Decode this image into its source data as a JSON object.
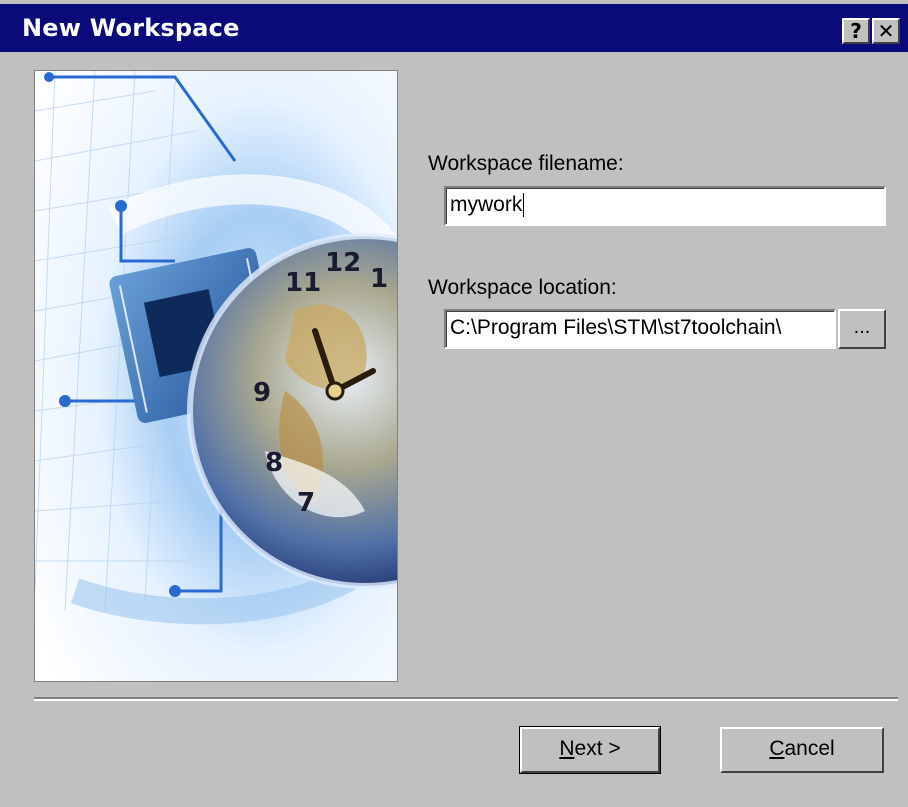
{
  "window": {
    "title": "New Workspace",
    "help_label": "?",
    "close_label": "✕"
  },
  "form": {
    "filename_label": "Workspace filename:",
    "filename_value": "mywork",
    "location_label": "Workspace location:",
    "location_value": "C:\\Program Files\\STM\\st7toolchain\\",
    "browse_label": "..."
  },
  "buttons": {
    "next_mnemonic": "N",
    "next_rest": "ext >",
    "cancel_mnemonic": "C",
    "cancel_rest": "ancel"
  },
  "artwork": {
    "subject": "circuit-board-and-globe-clock-illustration",
    "clock_numerals": [
      "12",
      "1",
      "11",
      "9",
      "8",
      "7"
    ]
  },
  "colors": {
    "titlebar": "#0a0a7a",
    "face": "#c0c0c0",
    "artwork_blue": "#2a6ad0"
  }
}
